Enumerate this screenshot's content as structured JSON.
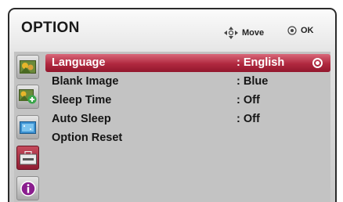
{
  "header": {
    "title": "OPTION",
    "move_label": "Move",
    "ok_label": "OK",
    "move_icon": "four-way-arrow-icon",
    "ok_icon": "enter-button-icon"
  },
  "sidebar": {
    "icons": [
      {
        "name": "picture-icon",
        "active": false
      },
      {
        "name": "picture-plus-icon",
        "active": false
      },
      {
        "name": "screen-icon",
        "active": false
      },
      {
        "name": "toolbox-icon",
        "active": true
      },
      {
        "name": "info-icon",
        "active": false
      }
    ]
  },
  "menu": {
    "items": [
      {
        "label": "Language",
        "value": ": English",
        "selected": true
      },
      {
        "label": "Blank Image",
        "value": ": Blue",
        "selected": false
      },
      {
        "label": "Sleep Time",
        "value": ": Off",
        "selected": false
      },
      {
        "label": "Auto Sleep",
        "value": ": Off",
        "selected": false
      },
      {
        "label": "Option Reset",
        "value": "",
        "selected": false
      }
    ]
  },
  "colors": {
    "accent": "#b0283f",
    "panel": "#c3c3c3"
  }
}
